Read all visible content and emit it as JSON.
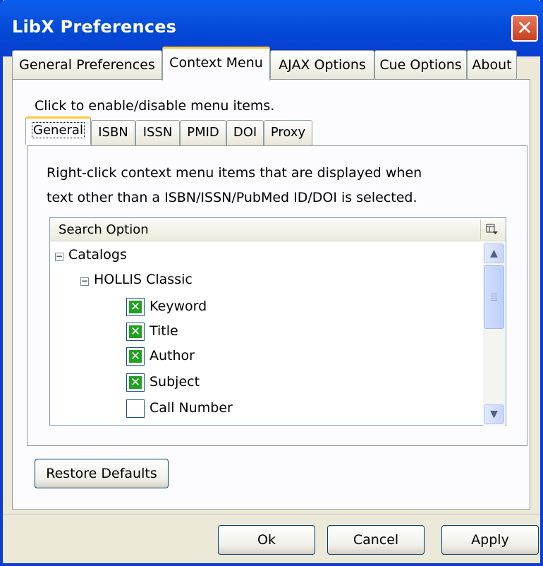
{
  "window": {
    "title": "LibX Preferences",
    "close_glyph": "✕"
  },
  "tabs": [
    {
      "label": "General Preferences",
      "active": false
    },
    {
      "label": "Context Menu",
      "active": true
    },
    {
      "label": "AJAX Options",
      "active": false
    },
    {
      "label": "Cue Options",
      "active": false
    },
    {
      "label": "About",
      "active": false
    }
  ],
  "context_menu": {
    "instruction": "Click to enable/disable menu items.",
    "subtabs": [
      {
        "label": "General",
        "active": true
      },
      {
        "label": "ISBN",
        "active": false
      },
      {
        "label": "ISSN",
        "active": false
      },
      {
        "label": "PMID",
        "active": false
      },
      {
        "label": "DOI",
        "active": false
      },
      {
        "label": "Proxy",
        "active": false
      }
    ],
    "description_line1": "Right-click context menu items that are displayed when",
    "description_line2": "text other than a ISBN/ISSN/PubMed ID/DOI is selected.",
    "tree": {
      "column_header": "Search Option",
      "column_picker_icon": "column-picker-icon",
      "catalogs_label": "Catalogs",
      "catalog_label": "HOLLIS Classic",
      "items": [
        {
          "label": "Keyword",
          "checked": true
        },
        {
          "label": "Title",
          "checked": true
        },
        {
          "label": "Author",
          "checked": true
        },
        {
          "label": "Subject",
          "checked": true
        },
        {
          "label": "Call Number",
          "checked": false
        }
      ]
    }
  },
  "buttons": {
    "restore_defaults": "Restore Defaults",
    "ok": "Ok",
    "cancel": "Cancel",
    "apply": "Apply"
  }
}
